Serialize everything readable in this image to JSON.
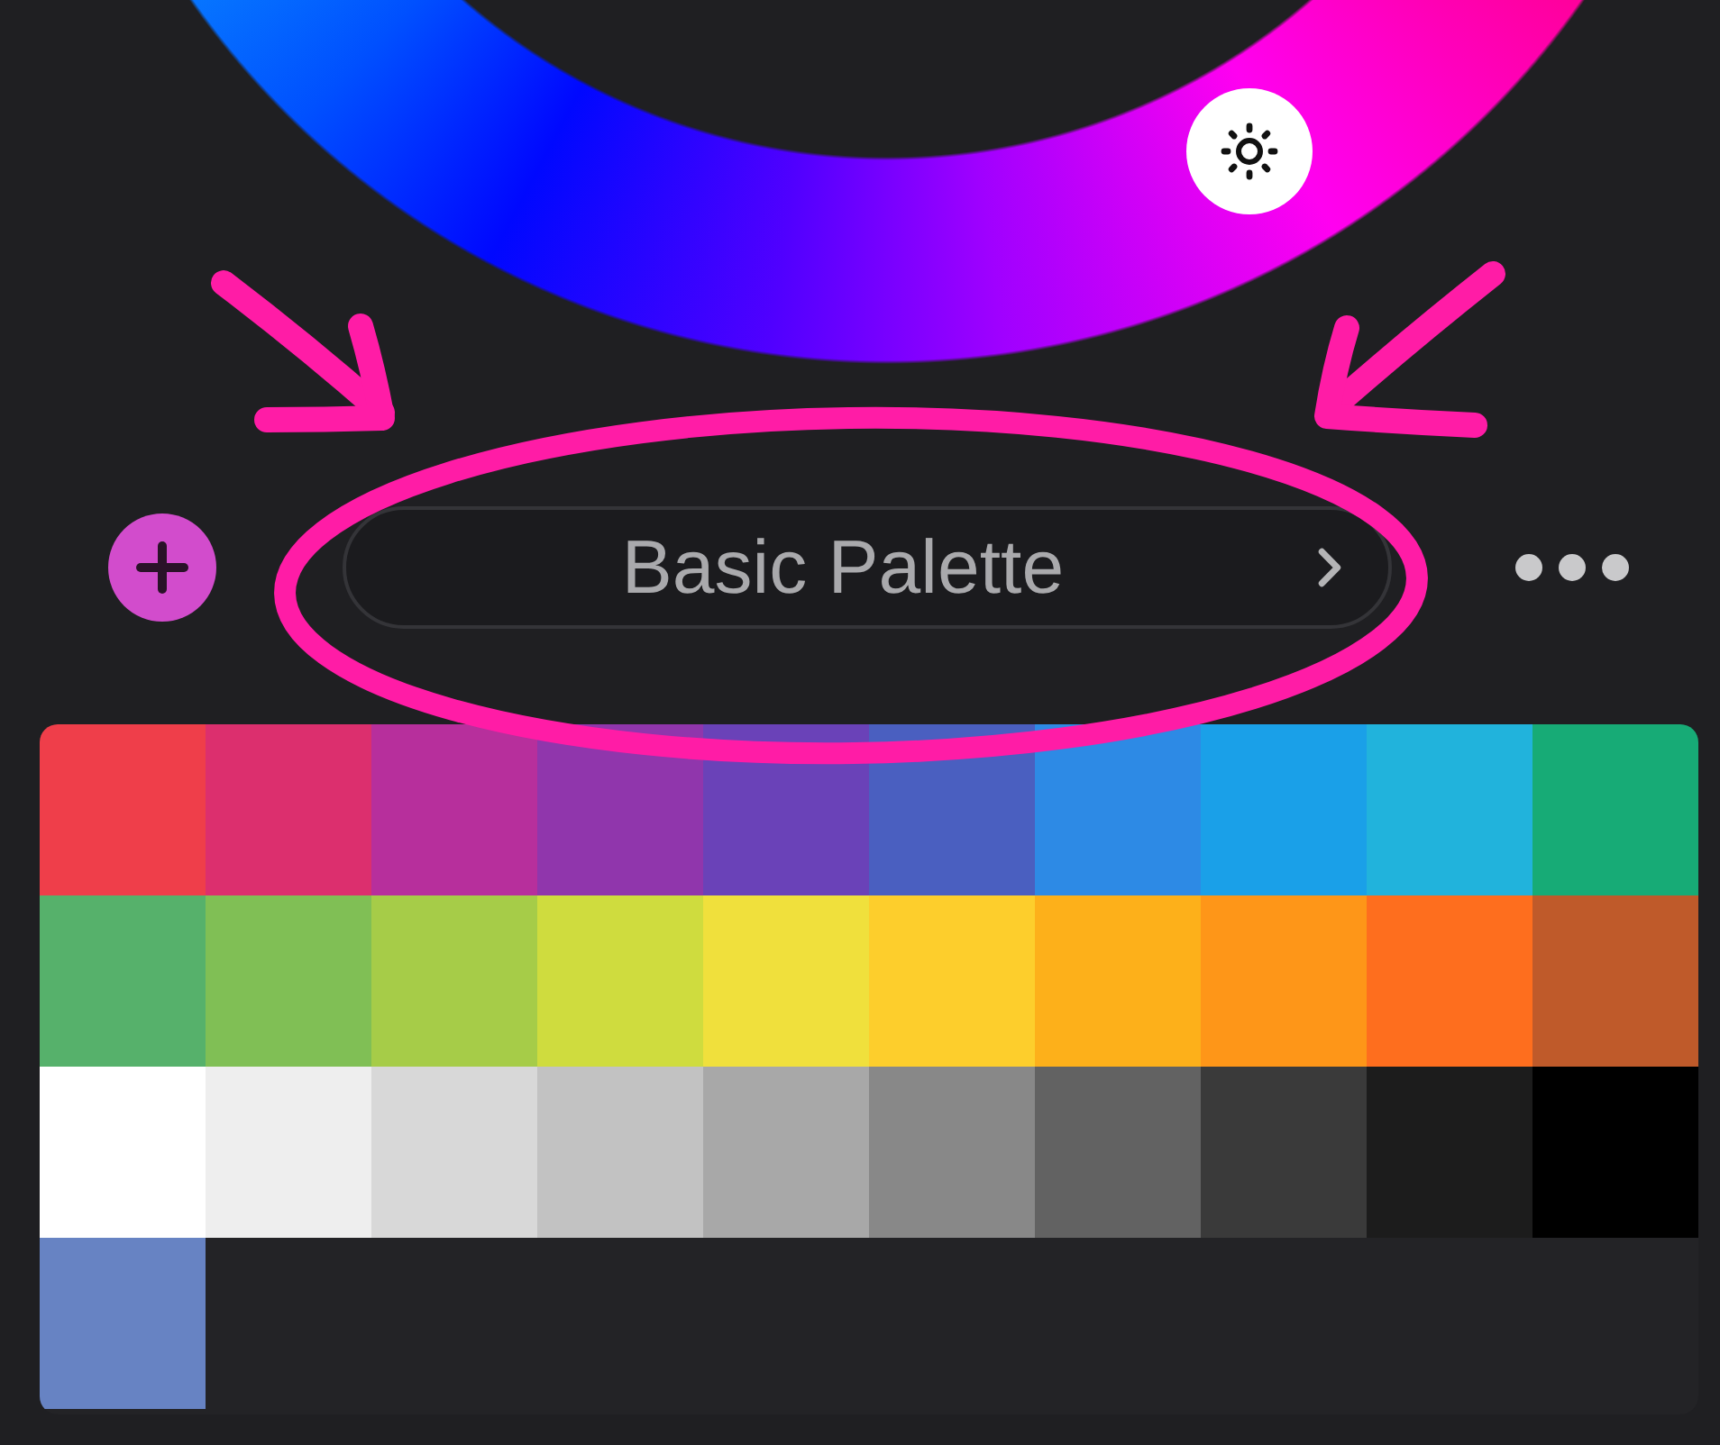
{
  "palette_selector": {
    "title": "Basic Palette"
  },
  "swatches": [
    {
      "color": "#ef3e4a"
    },
    {
      "color": "#dc2f6e"
    },
    {
      "color": "#b72f9c"
    },
    {
      "color": "#9036ac"
    },
    {
      "color": "#6a42b8"
    },
    {
      "color": "#4a5fc0"
    },
    {
      "color": "#2d8ae5"
    },
    {
      "color": "#1aa0e8"
    },
    {
      "color": "#21b3dc"
    },
    {
      "color": "#17ab76"
    },
    {
      "color": "#56b16b"
    },
    {
      "color": "#80bf55"
    },
    {
      "color": "#a6cc48"
    },
    {
      "color": "#cfdc3e"
    },
    {
      "color": "#f0e03c"
    },
    {
      "color": "#fdce2c"
    },
    {
      "color": "#fdb01a"
    },
    {
      "color": "#fe9618"
    },
    {
      "color": "#fe6e1e"
    },
    {
      "color": "#bf5a2a"
    },
    {
      "color": "#ffffff"
    },
    {
      "color": "#eeeeee"
    },
    {
      "color": "#d8d8d8"
    },
    {
      "color": "#c2c2c2"
    },
    {
      "color": "#a8a8a8"
    },
    {
      "color": "#888888"
    },
    {
      "color": "#626262"
    },
    {
      "color": "#3a3a3a"
    },
    {
      "color": "#1c1c1c"
    },
    {
      "color": "#000000"
    },
    {
      "color": "#6783c3"
    }
  ]
}
